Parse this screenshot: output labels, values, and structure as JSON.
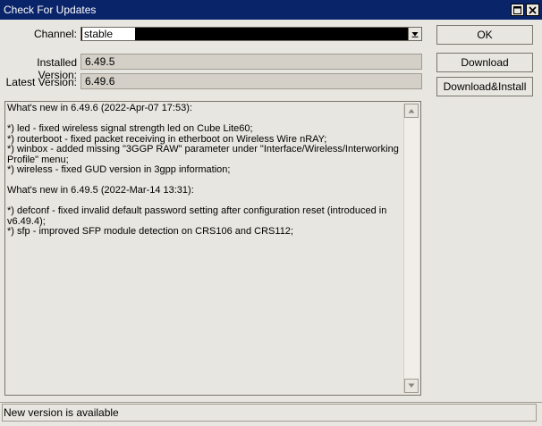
{
  "window": {
    "title": "Check For Updates"
  },
  "form": {
    "channel_label": "Channel:",
    "channel_value": "stable",
    "installed_label": "Installed Version:",
    "installed_value": "6.49.5",
    "latest_label": "Latest Version:",
    "latest_value": "6.49.6"
  },
  "buttons": {
    "ok": "OK",
    "download": "Download",
    "download_install": "Download&Install"
  },
  "notes": {
    "text": "What's new in 6.49.6 (2022-Apr-07 17:53):\n\n*) led - fixed wireless signal strength led on Cube Lite60;\n*) routerboot - fixed packet receiving in etherboot on Wireless Wire nRAY;\n*) winbox - added missing \"3GGP RAW\" parameter under \"Interface/Wireless/Interworking\nProfile\" menu;\n*) wireless - fixed GUD version in 3gpp information;\n\nWhat's new in 6.49.5 (2022-Mar-14 13:31):\n\n*) defconf - fixed invalid default password setting after configuration reset (introduced in\nv6.49.4);\n*) sfp - improved SFP module detection on CRS106 and CRS112;"
  },
  "status": {
    "text": "New version is available"
  },
  "icons": {
    "maximize": "maximize-icon",
    "close": "close-icon",
    "dropdown": "dropdown-arrow-icon",
    "scroll_up": "scroll-up-icon",
    "scroll_down": "scroll-down-icon"
  },
  "colors": {
    "titlebar": "#0a246a",
    "window": "#e8e6e0"
  }
}
